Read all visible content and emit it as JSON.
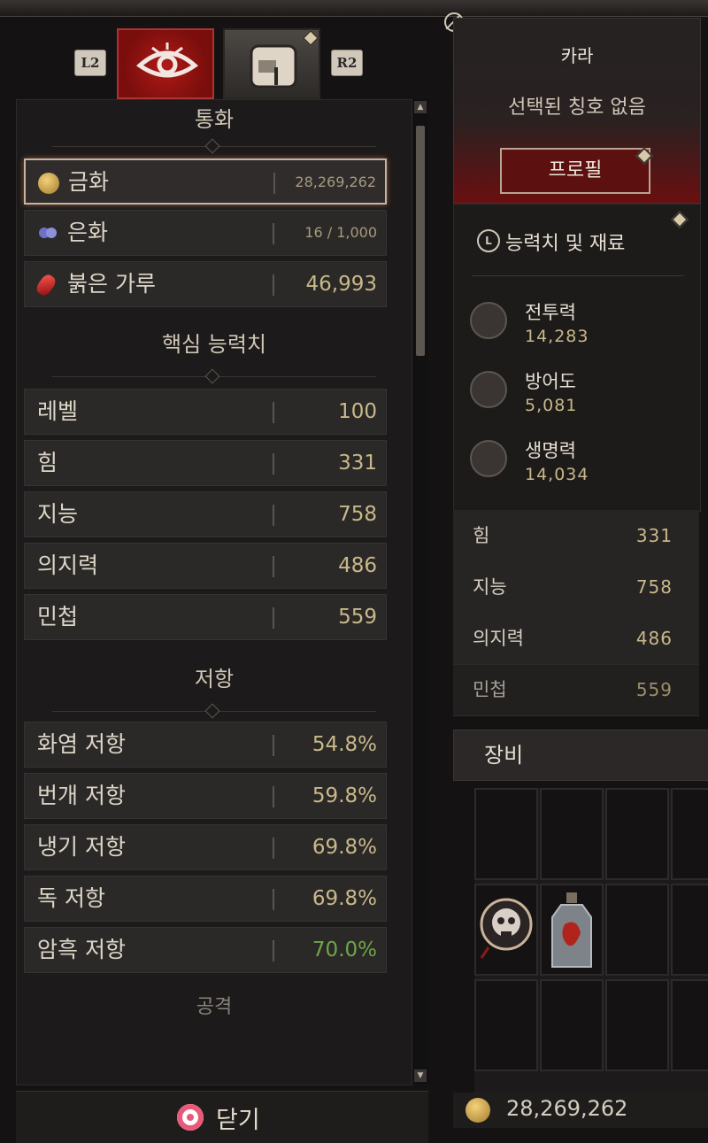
{
  "tabs": {
    "left_hint": "L2",
    "right_hint": "R2",
    "active_icon": "eye-icon",
    "inactive_icon": "backpack-icon"
  },
  "currency": {
    "title": "통화",
    "items": [
      {
        "label": "금화",
        "value": "28,269,262",
        "icon": "gold-coin-icon"
      },
      {
        "label": "은화",
        "value": "16 / 1,000",
        "icon": "silver-icon"
      },
      {
        "label": "붉은 가루",
        "value": "46,993",
        "icon": "red-dust-icon"
      }
    ]
  },
  "core": {
    "title": "핵심 능력치",
    "items": [
      {
        "label": "레벨",
        "value": "100"
      },
      {
        "label": "힘",
        "value": "331"
      },
      {
        "label": "지능",
        "value": "758"
      },
      {
        "label": "의지력",
        "value": "486"
      },
      {
        "label": "민첩",
        "value": "559"
      }
    ]
  },
  "resist": {
    "title": "저항",
    "items": [
      {
        "label": "화염 저항",
        "value": "54.8%"
      },
      {
        "label": "번개 저항",
        "value": "59.8%"
      },
      {
        "label": "냉기 저항",
        "value": "69.8%"
      },
      {
        "label": "독 저항",
        "value": "69.8%"
      },
      {
        "label": "암흑 저항",
        "value": "70.0%",
        "color": "#6fa54a"
      }
    ]
  },
  "attack": {
    "title": "공격"
  },
  "close": {
    "label": "닫기"
  },
  "profile": {
    "name": "카라",
    "title": "선택된 칭호 없음",
    "button": "프로필"
  },
  "stats": {
    "header": "능력치 및 재료",
    "main": [
      {
        "label": "전투력",
        "value": "14,283",
        "icon": "crossed-swords-icon"
      },
      {
        "label": "방어도",
        "value": "5,081",
        "icon": "shield-icon"
      },
      {
        "label": "생명력",
        "value": "14,034",
        "icon": "heart-icon"
      }
    ],
    "attrs": [
      {
        "label": "힘",
        "value": "331"
      },
      {
        "label": "지능",
        "value": "758"
      },
      {
        "label": "의지력",
        "value": "486"
      },
      {
        "label": "민첩",
        "value": "559"
      }
    ]
  },
  "equipment": {
    "title": "장비",
    "gold": "28,269,262"
  },
  "colors": {
    "accent_red": "#7a0e0c",
    "value_gold": "#c8b889",
    "resist_max_green": "#6fa54a"
  }
}
